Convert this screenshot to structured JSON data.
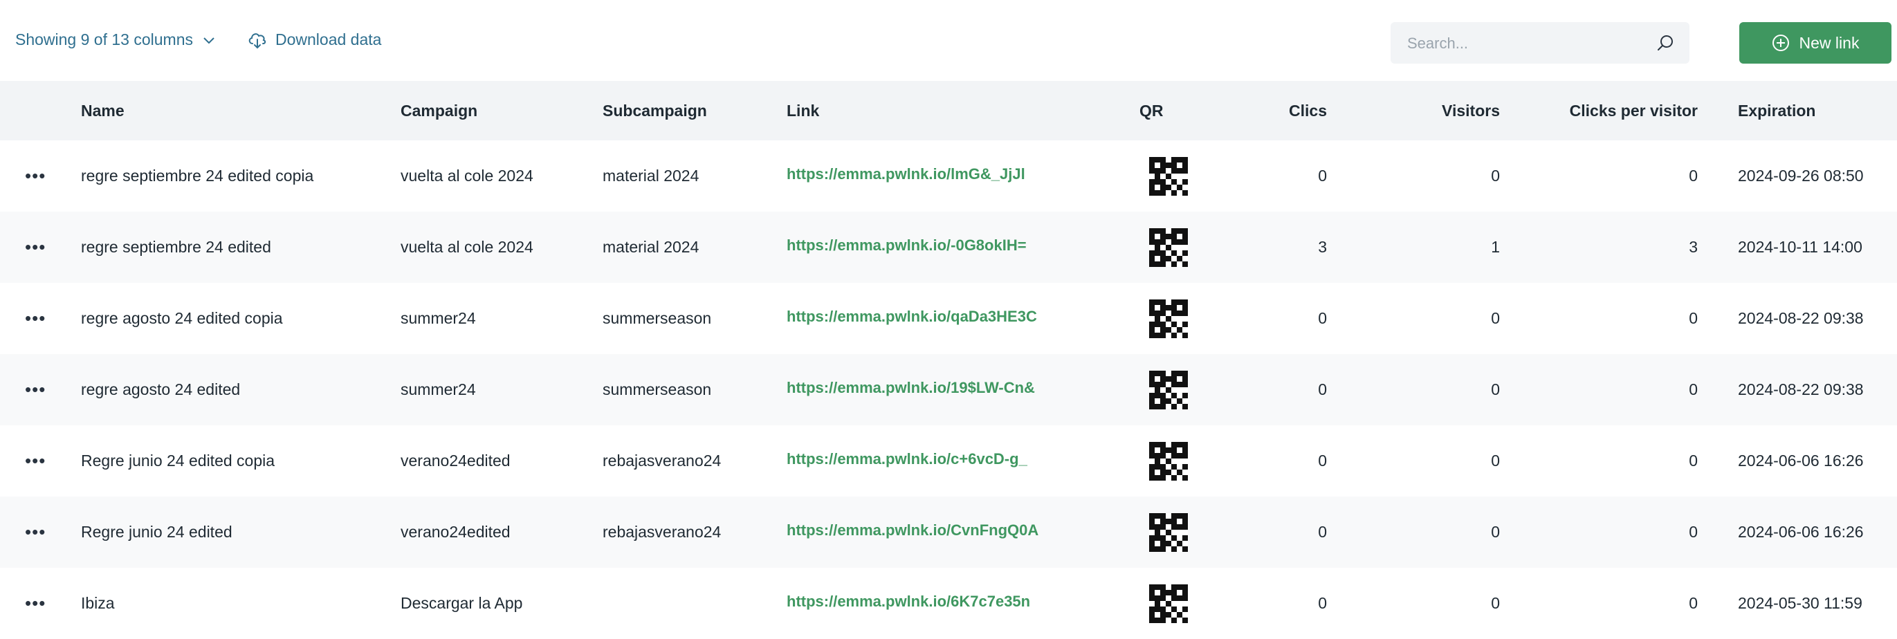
{
  "toolbar": {
    "columns_label": "Showing 9 of 13 columns",
    "download_label": "Download data",
    "search_placeholder": "Search...",
    "new_link_label": "New link",
    "accent": "#3f9760"
  },
  "table": {
    "headers": [
      "Name",
      "Campaign",
      "Subcampaign",
      "Link",
      "QR",
      "Clics",
      "Visitors",
      "Clicks per visitor",
      "Expiration"
    ],
    "rows": [
      {
        "name": "regre septiembre 24 edited copia",
        "campaign": "vuelta al cole 2024",
        "subcampaign": "material 2024",
        "link": "https://emma.pwlnk.io/lmG&_JjJl",
        "clics": "0",
        "visitors": "0",
        "cpv": "0",
        "expiration": "2024-09-26 08:50"
      },
      {
        "name": "regre septiembre 24 edited",
        "campaign": "vuelta al cole 2024",
        "subcampaign": "material 2024",
        "link": "https://emma.pwlnk.io/-0G8okIH=",
        "clics": "3",
        "visitors": "1",
        "cpv": "3",
        "expiration": "2024-10-11 14:00"
      },
      {
        "name": "regre agosto 24 edited copia",
        "campaign": "summer24",
        "subcampaign": "summerseason",
        "link": "https://emma.pwlnk.io/qaDa3HE3C",
        "clics": "0",
        "visitors": "0",
        "cpv": "0",
        "expiration": "2024-08-22 09:38"
      },
      {
        "name": "regre agosto 24 edited",
        "campaign": "summer24",
        "subcampaign": "summerseason",
        "link": "https://emma.pwlnk.io/19$LW-Cn&",
        "clics": "0",
        "visitors": "0",
        "cpv": "0",
        "expiration": "2024-08-22 09:38"
      },
      {
        "name": "Regre junio 24 edited copia",
        "campaign": "verano24edited",
        "subcampaign": "rebajasverano24",
        "link": "https://emma.pwlnk.io/c+6vcD-g_",
        "clics": "0",
        "visitors": "0",
        "cpv": "0",
        "expiration": "2024-06-06 16:26"
      },
      {
        "name": "Regre junio 24 edited",
        "campaign": "verano24edited",
        "subcampaign": "rebajasverano24",
        "link": "https://emma.pwlnk.io/CvnFngQ0A",
        "clics": "0",
        "visitors": "0",
        "cpv": "0",
        "expiration": "2024-06-06 16:26"
      },
      {
        "name": "Ibiza",
        "campaign": "Descargar la App",
        "subcampaign": "",
        "link": "https://emma.pwlnk.io/6K7c7e35n",
        "clics": "0",
        "visitors": "0",
        "cpv": "0",
        "expiration": "2024-05-30 11:59"
      }
    ]
  }
}
